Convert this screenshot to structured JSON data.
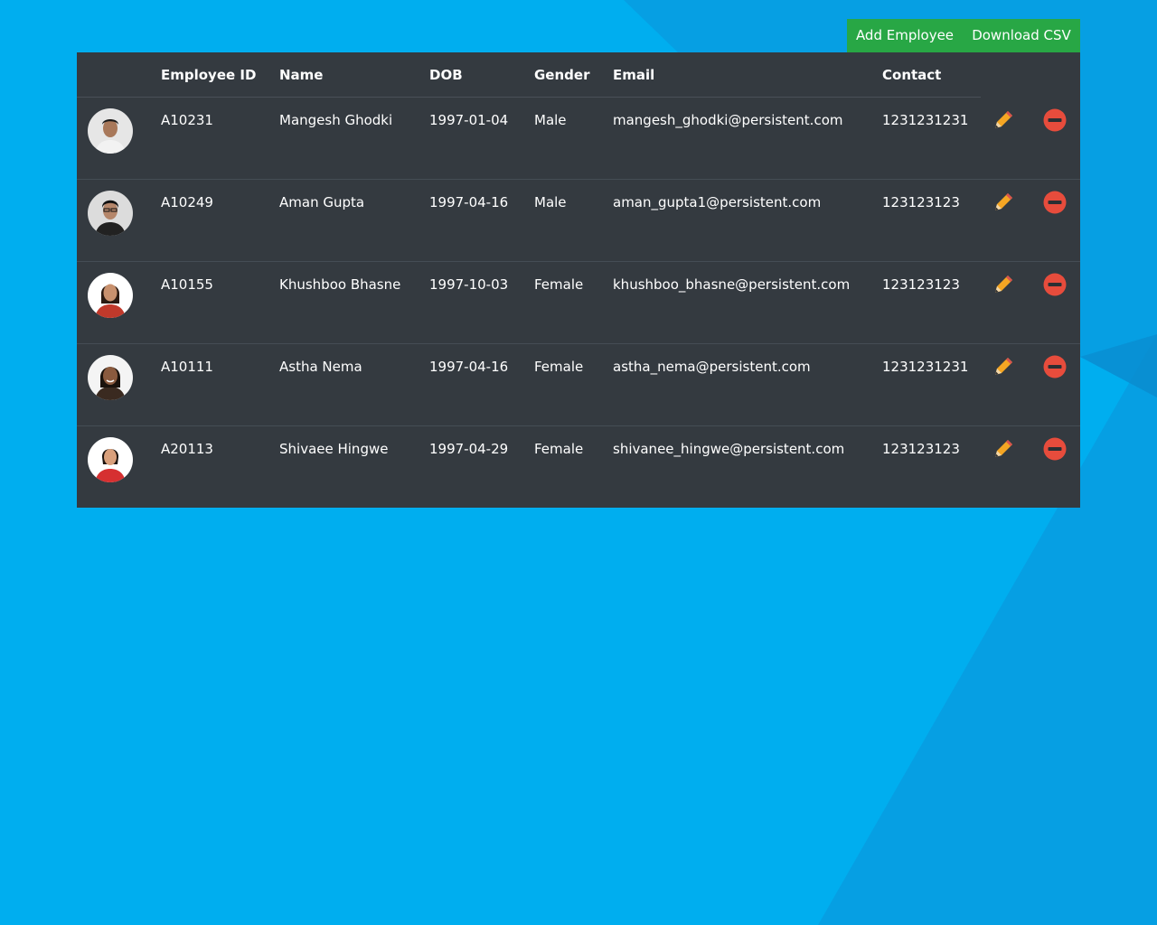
{
  "toolbar": {
    "add_label": "Add Employee",
    "csv_label": "Download CSV"
  },
  "table": {
    "headers": {
      "photo": "",
      "employee_id": "Employee ID",
      "name": "Name",
      "dob": "DOB",
      "gender": "Gender",
      "email": "Email",
      "contact": "Contact"
    },
    "rows": [
      {
        "employee_id": "A10231",
        "name": "Mangesh Ghodki",
        "dob": "1997-01-04",
        "gender": "Male",
        "email": "mangesh_ghodki@persistent.com",
        "contact": "1231231231"
      },
      {
        "employee_id": "A10249",
        "name": "Aman Gupta",
        "dob": "1997-04-16",
        "gender": "Male",
        "email": "aman_gupta1@persistent.com",
        "contact": "123123123"
      },
      {
        "employee_id": "A10155",
        "name": "Khushboo Bhasne",
        "dob": "1997-10-03",
        "gender": "Female",
        "email": "khushboo_bhasne@persistent.com",
        "contact": "123123123"
      },
      {
        "employee_id": "A10111",
        "name": "Astha Nema",
        "dob": "1997-04-16",
        "gender": "Female",
        "email": "astha_nema@persistent.com",
        "contact": "1231231231"
      },
      {
        "employee_id": "A20113",
        "name": "Shivaee Hingwe",
        "dob": "1997-04-29",
        "gender": "Female",
        "email": "shivanee_hingwe@persistent.com",
        "contact": "123123123"
      }
    ]
  },
  "icons": {
    "edit": "pencil-icon",
    "delete": "minus-circle-icon"
  },
  "colors": {
    "background": "#00aeef",
    "table": "#343a40",
    "button": "#28a745",
    "delete": "#e74c3c",
    "pencil": "#f5a623"
  }
}
